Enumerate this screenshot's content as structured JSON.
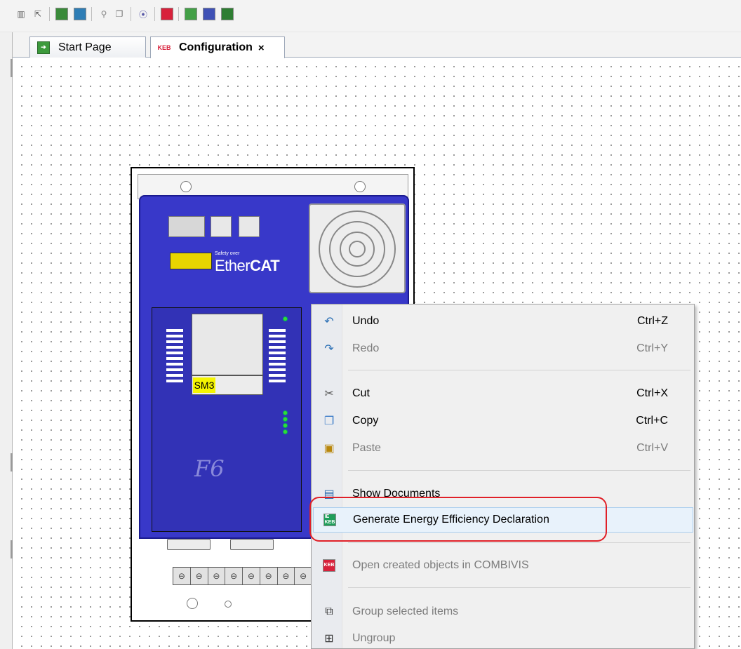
{
  "toolbar": {
    "icons": [
      "new-document-icon",
      "export-icon",
      "keb-device-icon",
      "keb-device-add-icon",
      "find-icon",
      "copy-page-icon",
      "chart-icon",
      "keb-config-icon",
      "network-icon",
      "module-icon",
      "group-icon"
    ]
  },
  "tabs": [
    {
      "label": "Start Page",
      "icon": "start-page-icon",
      "active": false
    },
    {
      "label": "Configuration",
      "icon": "configuration-icon",
      "active": true
    }
  ],
  "device": {
    "ethercat_text": "Ether",
    "ethercat_bold": "CAT",
    "safety_text": "Safety over",
    "module_label": "SM3",
    "model_label": "F6"
  },
  "context_menu": {
    "items": [
      {
        "label": "Undo",
        "shortcut": "Ctrl+Z",
        "icon": "undo-icon",
        "enabled": true
      },
      {
        "label": "Redo",
        "shortcut": "Ctrl+Y",
        "icon": "redo-icon",
        "enabled": false
      },
      {
        "label": "Cut",
        "shortcut": "Ctrl+X",
        "icon": "cut-icon",
        "enabled": true
      },
      {
        "label": "Copy",
        "shortcut": "Ctrl+C",
        "icon": "copy-icon",
        "enabled": true
      },
      {
        "label": "Paste",
        "shortcut": "Ctrl+V",
        "icon": "paste-icon",
        "enabled": false
      },
      {
        "label": "Show Documents",
        "shortcut": "",
        "icon": "show-documents-icon",
        "enabled": true
      },
      {
        "label": "Generate Energy Efficiency Declaration",
        "shortcut": "",
        "icon": "energy-efficiency-icon",
        "enabled": true,
        "hovered": true
      },
      {
        "label": "Open created objects in COMBIVIS",
        "shortcut": "",
        "icon": "open-combivis-icon",
        "enabled": false
      },
      {
        "label": "Group selected items",
        "shortcut": "",
        "icon": "group-icon",
        "enabled": false
      },
      {
        "label": "Ungroup",
        "shortcut": "",
        "icon": "ungroup-icon",
        "enabled": false
      }
    ]
  },
  "colors": {
    "device_blue": "#3838c9",
    "highlight_red": "#e02028",
    "menu_hover": "#e8f2fb"
  }
}
